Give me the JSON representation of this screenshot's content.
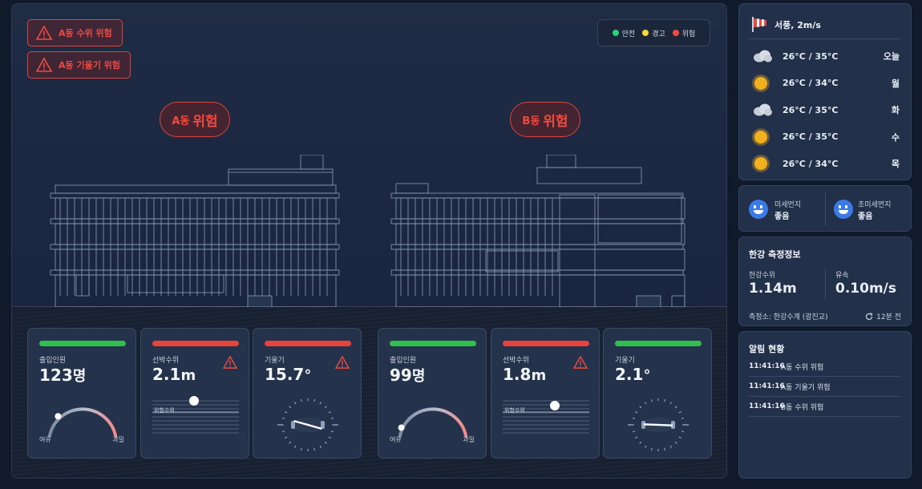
{
  "alerts_top": [
    "A동 수위 위험",
    "A동 기울기 위험"
  ],
  "legend": [
    {
      "label": "안전",
      "color": "#2bd27a"
    },
    {
      "label": "경고",
      "color": "#f4d63a"
    },
    {
      "label": "위험",
      "color": "#ee4a40"
    }
  ],
  "buildings": [
    {
      "name": "A동",
      "status": "위험"
    },
    {
      "name": "B동",
      "status": "위험"
    }
  ],
  "cards": [
    {
      "label": "출입인원",
      "value": "123",
      "unit": "명",
      "bar_color": "#2fbf4a",
      "warn": false,
      "gauge_low": "여유",
      "gauge_high": "과밀",
      "gauge_fraction": 0.2
    },
    {
      "label": "선박수위",
      "value": "2.1",
      "unit": "m",
      "bar_color": "#e8423a",
      "warn": true,
      "marker_label": "위험수위"
    },
    {
      "label": "기울기",
      "value": "15.7",
      "unit": "°",
      "bar_color": "#e8423a",
      "warn": true,
      "angle": 15.7
    },
    {
      "label": "출입인원",
      "value": "99",
      "unit": "명",
      "bar_color": "#2fbf4a",
      "warn": false,
      "gauge_low": "여유",
      "gauge_high": "과밀",
      "gauge_fraction": 0.05
    },
    {
      "label": "선박수위",
      "value": "1.8",
      "unit": "m",
      "bar_color": "#e8423a",
      "warn": true,
      "marker_label": "위험수위"
    },
    {
      "label": "기울기",
      "value": "2.1",
      "unit": "°",
      "bar_color": "#2fbf4a",
      "warn": false,
      "angle": 2.1
    }
  ],
  "weather": {
    "wind": "서풍, 2m/s",
    "days": [
      {
        "icon": "cloud-icon",
        "temp": "26°C / 35°C",
        "day": "오늘"
      },
      {
        "icon": "sun-icon",
        "temp": "26°C / 34°C",
        "day": "월"
      },
      {
        "icon": "cloud-icon",
        "temp": "26°C / 35°C",
        "day": "화"
      },
      {
        "icon": "sun-icon",
        "temp": "26°C / 35°C",
        "day": "수"
      },
      {
        "icon": "sun-icon",
        "temp": "26°C / 34°C",
        "day": "목"
      }
    ]
  },
  "dust": [
    {
      "label": "미세먼지",
      "value": "좋음"
    },
    {
      "label": "초미세먼지",
      "value": "좋음"
    }
  ],
  "river": {
    "title": "한강 측정정보",
    "level_label": "한강수위",
    "level_value": "1.14",
    "level_unit": "m",
    "flow_label": "유속",
    "flow_value": "0.10",
    "flow_unit": "m/s",
    "station": "측정소: 한강수계 (광진교)",
    "updated": "12분 전"
  },
  "alerts_panel": {
    "title": "알림 현황",
    "rows": [
      {
        "time": "11:41:16",
        "msg": "A동 수위 위험"
      },
      {
        "time": "11:41:16",
        "msg": "A동 기울기 위험"
      },
      {
        "time": "11:41:16",
        "msg": "B동 수위 위험"
      }
    ]
  }
}
